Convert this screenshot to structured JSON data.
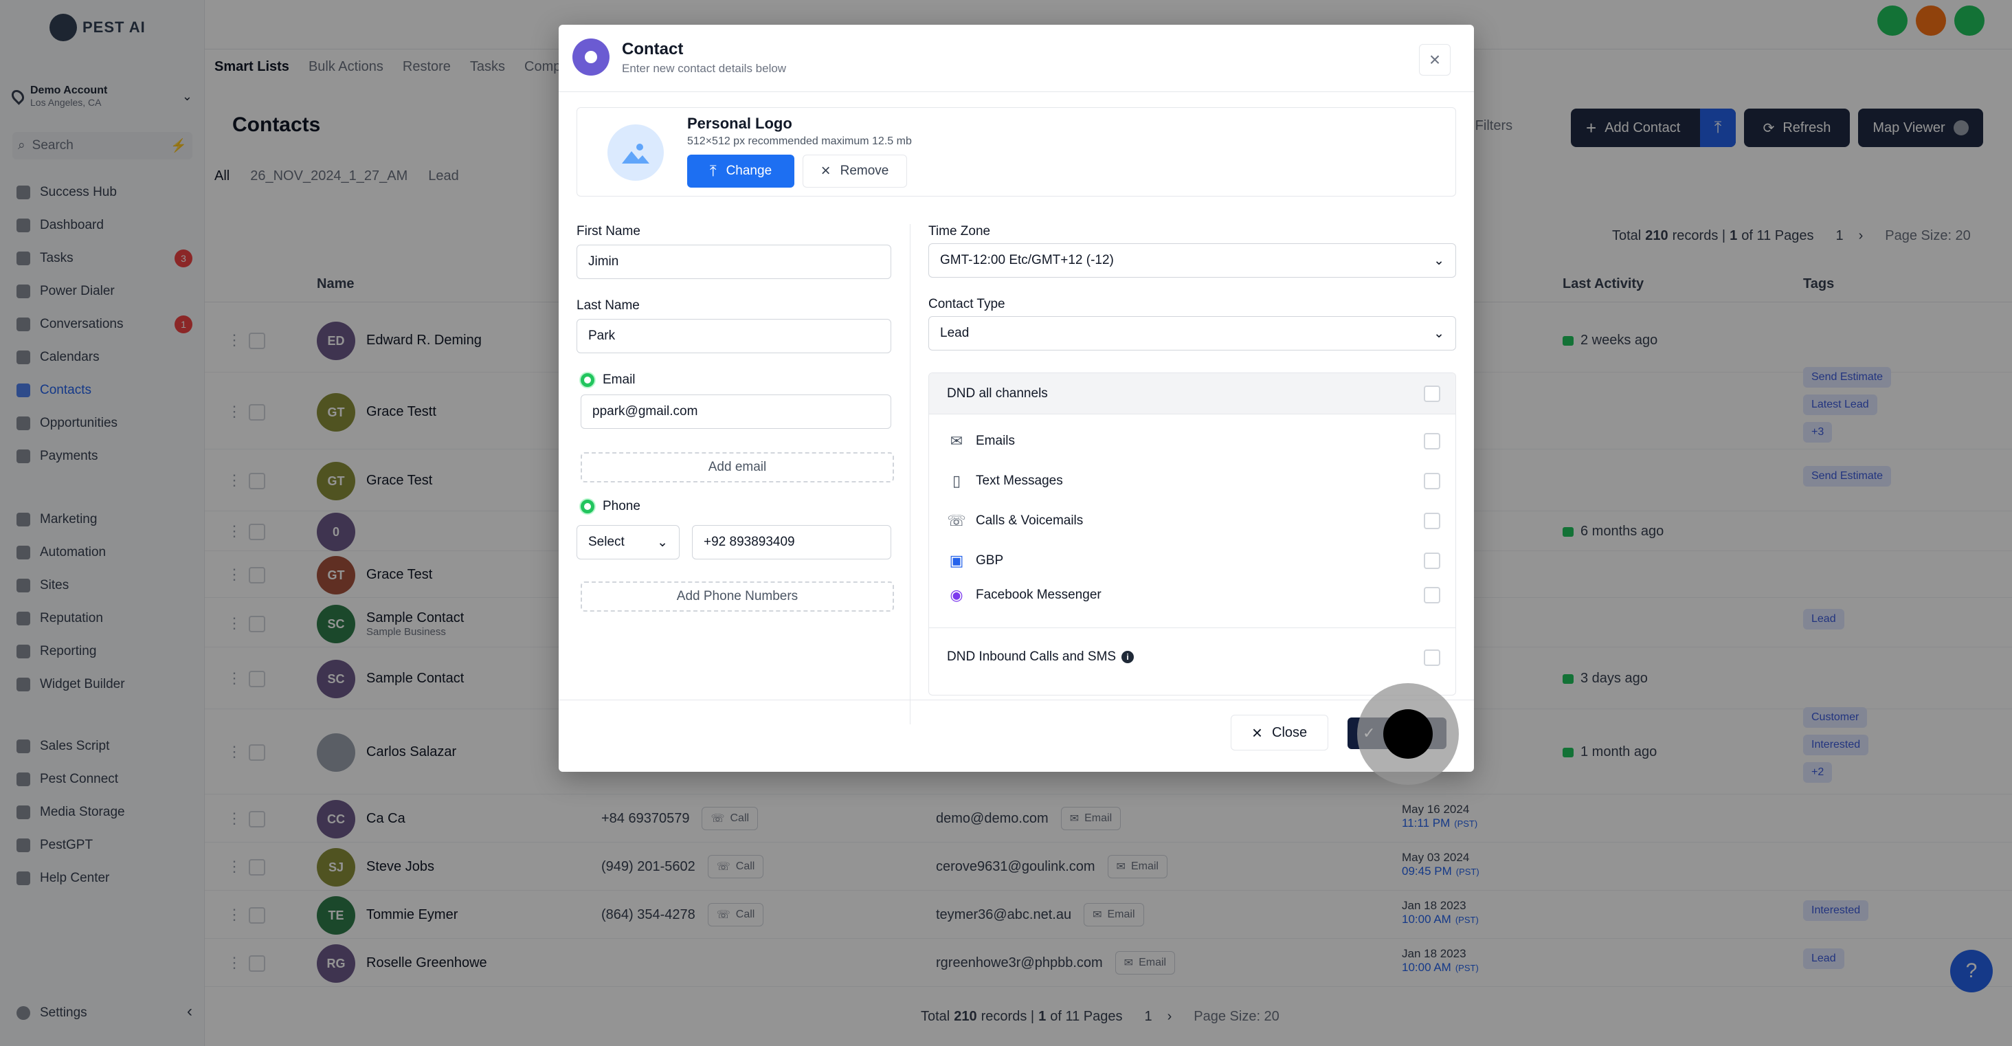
{
  "app": {
    "logo_text": "PEST AI",
    "account_name": "Demo Account",
    "account_location": "Los Angeles, CA",
    "search_placeholder": "Search"
  },
  "sidebar": {
    "items": [
      {
        "label": "Success Hub",
        "icon": "trophy-icon"
      },
      {
        "label": "Dashboard",
        "icon": "grid-icon"
      },
      {
        "label": "Tasks",
        "icon": "checklist-icon",
        "badge": "3"
      },
      {
        "label": "Power Dialer",
        "icon": "phone-icon"
      },
      {
        "label": "Conversations",
        "icon": "chat-icon",
        "badge": "1"
      },
      {
        "label": "Calendars",
        "icon": "calendar-icon"
      },
      {
        "label": "Contacts",
        "icon": "user-icon",
        "active": true
      },
      {
        "label": "Opportunities",
        "icon": "filter-icon"
      },
      {
        "label": "Payments",
        "icon": "card-icon"
      }
    ],
    "items2": [
      {
        "label": "Marketing",
        "icon": "megaphone-icon"
      },
      {
        "label": "Automation",
        "icon": "gear-icon"
      },
      {
        "label": "Sites",
        "icon": "globe-icon"
      },
      {
        "label": "Reputation",
        "icon": "star-icon"
      },
      {
        "label": "Reporting",
        "icon": "chart-icon"
      },
      {
        "label": "Widget Builder",
        "icon": "widget-icon"
      }
    ],
    "items3": [
      {
        "label": "Sales Script",
        "icon": "script-icon"
      },
      {
        "label": "Pest Connect",
        "icon": "link-icon"
      },
      {
        "label": "Media Storage",
        "icon": "image-icon"
      },
      {
        "label": "PestGPT",
        "icon": "robot-icon"
      },
      {
        "label": "Help Center",
        "icon": "help-icon"
      }
    ],
    "settings": "Settings"
  },
  "page": {
    "tabs": [
      "Smart Lists",
      "Bulk Actions",
      "Restore",
      "Tasks",
      "Compa"
    ],
    "title": "Contacts",
    "subtabs": [
      "All",
      "26_NOV_2024_1_27_AM",
      "Lead"
    ],
    "filters_label": "e Filters",
    "add_contact": "Add Contact",
    "refresh": "Refresh",
    "map_viewer": "Map Viewer",
    "pagination": {
      "prefix": "Total",
      "total": "210",
      "records": "records |",
      "page": "1",
      "of": "of 11 Pages",
      "current": "1",
      "page_size": "Page Size: 20"
    },
    "columns": {
      "name": "Name",
      "last_activity": "Last Activity",
      "tags": "Tags"
    },
    "call_label": "Call",
    "email_label": "Email"
  },
  "rows": [
    {
      "initials": "ED",
      "name": "Edward R. Deming",
      "activity": "2 weeks ago",
      "color": "#6d5a8a"
    },
    {
      "initials": "GT",
      "name": "Grace Testt",
      "tags": [
        "Send Estimate",
        "Latest Lead",
        "+3"
      ],
      "color": "#8a8f3a"
    },
    {
      "initials": "GT",
      "name": "Grace Test",
      "tags": [
        "Send Estimate"
      ],
      "color": "#8a8f3a"
    },
    {
      "initials": "0",
      "name": "",
      "activity": "6 months ago",
      "color": "#6d5a8a"
    },
    {
      "initials": "GT",
      "name": "Grace Test",
      "color": "#a5523d"
    },
    {
      "initials": "SC",
      "name": "Sample Contact",
      "sub": "Sample Business",
      "tags": [
        "Lead"
      ],
      "color": "#2f7d4a"
    },
    {
      "initials": "SC",
      "name": "Sample Contact",
      "activity": "3 days ago",
      "color": "#6d5a8a"
    },
    {
      "initials": "",
      "name": "Carlos Salazar",
      "activity": "1 month ago",
      "tags": [
        "Customer",
        "Interested",
        "+2"
      ],
      "color": "#9ca3af"
    },
    {
      "initials": "CC",
      "name": "Ca Ca",
      "phone": "+84 69370579",
      "email": "demo@demo.com",
      "date": "May 16 2024",
      "time": "11:11 PM",
      "color": "#6d5a8a"
    },
    {
      "initials": "SJ",
      "name": "Steve Jobs",
      "phone": "(949) 201-5602",
      "email": "cerove9631@goulink.com",
      "date": "May 03 2024",
      "time": "09:45 PM",
      "color": "#8a8f3a"
    },
    {
      "initials": "TE",
      "name": "Tommie Eymer",
      "phone": "(864) 354-4278",
      "email": "teymer36@abc.net.au",
      "date": "Jan 18 2023",
      "time": "10:00 AM",
      "tags": [
        "Interested"
      ],
      "color": "#2f7d4a"
    },
    {
      "initials": "RG",
      "name": "Roselle Greenhowe",
      "phone": "",
      "email": "rgreenhowe3r@phpbb.com",
      "date": "Jan 18 2023",
      "time": "10:00 AM",
      "tags": [
        "Lead"
      ],
      "color": "#6d5a8a"
    }
  ],
  "tz_suffix": "(PST)",
  "modal": {
    "title": "Contact",
    "subtitle": "Enter new contact details below",
    "logo_title": "Personal Logo",
    "logo_hint": "512×512 px recommended maximum 12.5 mb",
    "change": "Change",
    "remove": "Remove",
    "first_name_label": "First Name",
    "first_name": "Jimin",
    "last_name_label": "Last Name",
    "last_name": "Park",
    "email_label": "Email",
    "email": "ppark@gmail.com",
    "add_email": "Add email",
    "phone_label": "Phone",
    "phone_country": "Select",
    "phone": "+92 893893409",
    "add_phone": "Add Phone Numbers",
    "timezone_label": "Time Zone",
    "timezone": "GMT-12:00 Etc/GMT+12 (-12)",
    "contact_type_label": "Contact Type",
    "contact_type": "Lead",
    "dnd_all": "DND all channels",
    "dnd_channels": [
      {
        "label": "Emails",
        "icon": "envelope-icon"
      },
      {
        "label": "Text Messages",
        "icon": "mobile-icon"
      },
      {
        "label": "Calls & Voicemails",
        "icon": "phone-icon"
      },
      {
        "label": "GBP",
        "icon": "gbp-icon"
      },
      {
        "label": "Facebook Messenger",
        "icon": "messenger-icon"
      }
    ],
    "dnd_inbound": "DND Inbound Calls and SMS",
    "close": "Close"
  },
  "colors": {
    "primary": "#1d6ff2",
    "dark_button": "#1f2a44",
    "modal_save": "#111c3a",
    "accent_purple": "#6b5bd2"
  }
}
